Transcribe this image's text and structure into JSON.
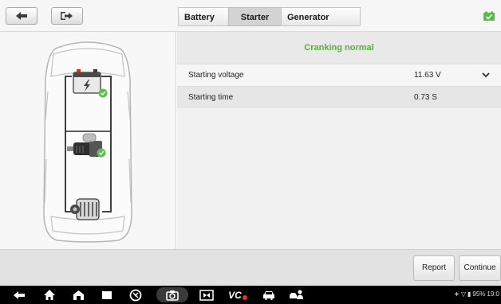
{
  "toolbar": {
    "back_icon": "back-arrow-icon",
    "exit_icon": "exit-icon",
    "status_icon": "battery-check-icon"
  },
  "tabs": [
    {
      "label": "Battery",
      "active": false
    },
    {
      "label": "Starter",
      "active": true
    },
    {
      "label": "Generator",
      "active": false
    }
  ],
  "panel": {
    "status": "Cranking normal",
    "status_color": "#58ad3f",
    "rows": [
      {
        "label": "Starting voltage",
        "value": "11.63 V",
        "expandable": true
      },
      {
        "label": "Starting time",
        "value": "0.73 S",
        "expandable": false
      }
    ]
  },
  "diagram": {
    "components": [
      "battery-icon",
      "starter-motor-icon",
      "generator-icon"
    ],
    "ok_color": "#5cc04a"
  },
  "actions": {
    "report_label": "Report",
    "continue_label": "Continue"
  },
  "system_bar": {
    "icons": [
      "back-icon",
      "home-icon",
      "house-icon",
      "recent-apps-icon",
      "browser-icon",
      "camera-icon",
      "screen-record-icon",
      "vci-icon",
      "car-icon",
      "user-car-icon"
    ],
    "vci_label": "VC",
    "battery_text": "95%",
    "time": "19:0"
  }
}
